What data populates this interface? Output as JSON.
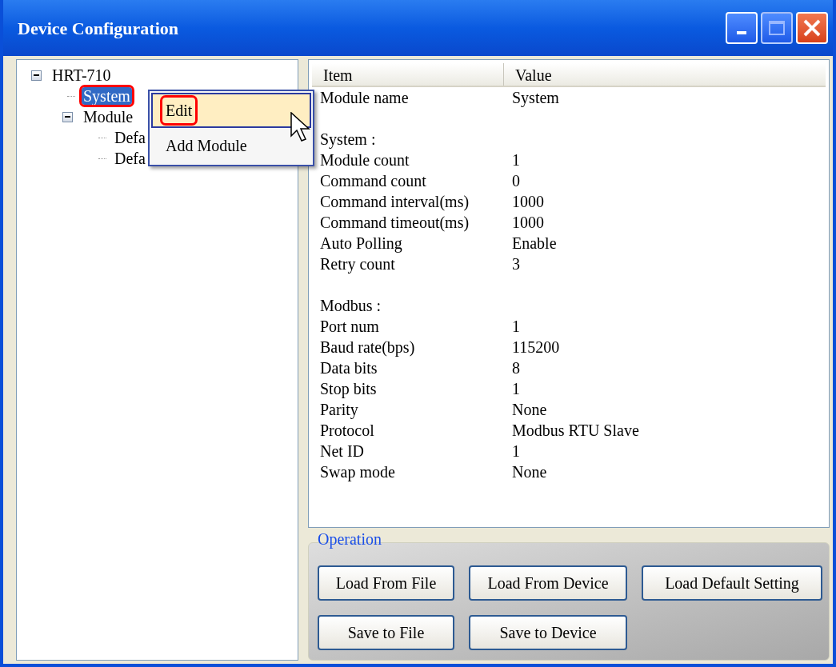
{
  "window": {
    "title": "Device Configuration"
  },
  "tree": [
    {
      "label": "HRT-710",
      "expanded": true,
      "selected": false,
      "highlighted": false,
      "children": [
        {
          "label": "System",
          "selected": true,
          "highlighted": true
        },
        {
          "label": "Module",
          "expanded": true,
          "selected": false,
          "highlighted": false,
          "children": [
            {
              "label": "Defa",
              "selected": false,
              "highlighted": false
            },
            {
              "label": "Defa",
              "selected": false,
              "highlighted": false
            }
          ]
        }
      ]
    }
  ],
  "context_menu": [
    {
      "label": "Edit",
      "selected": true,
      "highlighted": true
    },
    {
      "label": "Add Module",
      "selected": false,
      "highlighted": false
    }
  ],
  "list": {
    "columns": [
      "Item",
      "Value"
    ],
    "rows": [
      {
        "kind": "pair",
        "item": "Module name",
        "value": "System"
      },
      {
        "kind": "blank"
      },
      {
        "kind": "section",
        "item": "System :"
      },
      {
        "kind": "pair",
        "item": "Module count",
        "value": "1"
      },
      {
        "kind": "pair",
        "item": "Command count",
        "value": "0"
      },
      {
        "kind": "pair",
        "item": "Command interval(ms)",
        "value": "1000"
      },
      {
        "kind": "pair",
        "item": "Command timeout(ms)",
        "value": "1000"
      },
      {
        "kind": "pair",
        "item": "Auto Polling",
        "value": "Enable"
      },
      {
        "kind": "pair",
        "item": "Retry count",
        "value": "3"
      },
      {
        "kind": "blank"
      },
      {
        "kind": "section",
        "item": "Modbus :"
      },
      {
        "kind": "pair",
        "item": "Port num",
        "value": "1"
      },
      {
        "kind": "pair",
        "item": "Baud rate(bps)",
        "value": "115200"
      },
      {
        "kind": "pair",
        "item": "Data bits",
        "value": "8"
      },
      {
        "kind": "pair",
        "item": "Stop bits",
        "value": "1"
      },
      {
        "kind": "pair",
        "item": "Parity",
        "value": "None"
      },
      {
        "kind": "pair",
        "item": "Protocol",
        "value": "Modbus RTU Slave"
      },
      {
        "kind": "pair",
        "item": "Net ID",
        "value": "1"
      },
      {
        "kind": "pair",
        "item": "Swap mode",
        "value": "None"
      }
    ]
  },
  "operation": {
    "title": "Operation",
    "buttons": [
      [
        "Load From File",
        "Load From Device",
        "Load Default Setting"
      ],
      [
        "Save to File",
        "Save to Device"
      ]
    ]
  }
}
